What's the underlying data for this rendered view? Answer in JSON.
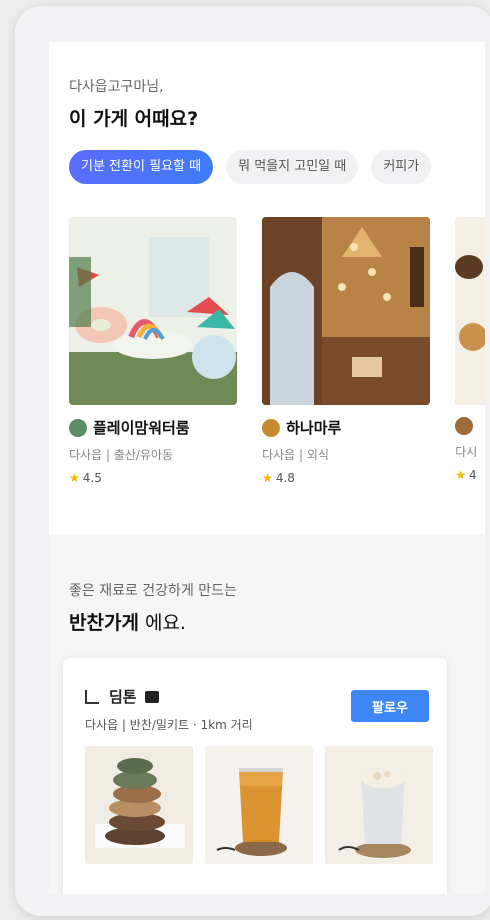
{
  "greeting": "다사읍고구마님,",
  "question": "이 가게 어때요?",
  "chips": [
    "기분 전환이 필요할 때",
    "뭐 먹을지 고민일 때",
    "커피가"
  ],
  "stores": [
    {
      "name": "플레이맘워터룸",
      "area": "다사읍",
      "category": "출산/유아동",
      "rating": "4.5"
    },
    {
      "name": "하나마루",
      "area": "다사읍",
      "category": "외식",
      "rating": "4.8"
    },
    {
      "name": "",
      "area": "다시",
      "category": "",
      "rating": "4"
    }
  ],
  "section2": {
    "subtitle": "좋은 재료로 건강하게 만드는",
    "title_bold": "반찬가게",
    "title_rest": " 에요.",
    "shop": {
      "name": "딤톤",
      "meta": "다사읍 | 반찬/밀키트 · 1km 거리",
      "follow_label": "팔로우"
    }
  },
  "icons": {
    "star": "star-icon"
  },
  "colors": {
    "accent": "#3d86f5",
    "chip_active": "#5b6cff"
  }
}
